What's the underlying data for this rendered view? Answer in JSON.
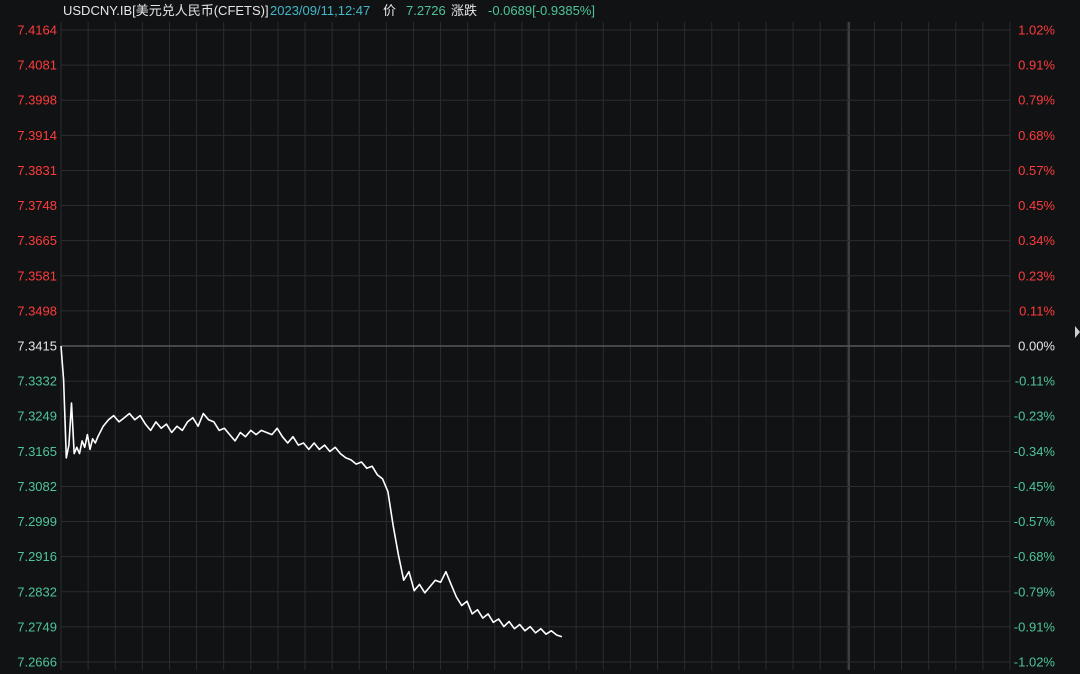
{
  "header": {
    "symbol": "USDCNY.IB[美元兑人民币(CFETS)]",
    "time": "2023/09/11,12:47",
    "price_label": "价",
    "price_value": "7.2726",
    "change_label": "涨跌",
    "change_value": "-0.0689[-0.9385%]"
  },
  "colors": {
    "background": "#111214",
    "grid": "#2b2c31",
    "baseline": "#55575c",
    "up": "#ff3b3b",
    "down": "#4ec49a",
    "neutral": "#e6e6e6",
    "line": "#ffffff"
  },
  "chart_data": {
    "type": "line",
    "title": "",
    "xlabel": "",
    "ylabel": "",
    "ylim": [
      7.2666,
      7.4164
    ],
    "reference_price": 7.3415,
    "grid": true,
    "y_ticks_left": [
      "7.4164",
      "7.4081",
      "7.3998",
      "7.3914",
      "7.3831",
      "7.3748",
      "7.3665",
      "7.3581",
      "7.3498",
      "7.3415",
      "7.3332",
      "7.3249",
      "7.3165",
      "7.3082",
      "7.2999",
      "7.2916",
      "7.2832",
      "7.2749",
      "7.2666"
    ],
    "y_ticks_right": [
      "1.02%",
      "0.91%",
      "0.79%",
      "0.68%",
      "0.57%",
      "0.45%",
      "0.34%",
      "0.23%",
      "0.11%",
      "0.00%",
      "-0.11%",
      "-0.23%",
      "-0.34%",
      "-0.45%",
      "-0.57%",
      "-0.68%",
      "-0.79%",
      "-0.91%",
      "-1.02%"
    ],
    "x_range": [
      0,
      360
    ],
    "series": [
      {
        "x": [
          0,
          1,
          2,
          3,
          4,
          5,
          6,
          7,
          8,
          9,
          10,
          11,
          12,
          13,
          14,
          16,
          18,
          20,
          22,
          24,
          26,
          28,
          30,
          32,
          34,
          36,
          38,
          40,
          42,
          44,
          46,
          48,
          50,
          52,
          54,
          56,
          58,
          60,
          62,
          64,
          66,
          68,
          70,
          72,
          74,
          76,
          78,
          80,
          82,
          84,
          86,
          88,
          90,
          92,
          94,
          96,
          98,
          100,
          102,
          104,
          106,
          108,
          110,
          112,
          114,
          116,
          118,
          120,
          122,
          124,
          126,
          128,
          130,
          132,
          134,
          136,
          138,
          140,
          142,
          144,
          146,
          148,
          150,
          152,
          154,
          156,
          158,
          160,
          162,
          164,
          166,
          168,
          170,
          172,
          174,
          176,
          178,
          180,
          182,
          184,
          186,
          188,
          190
        ],
        "y": [
          7.3415,
          7.3335,
          7.315,
          7.318,
          7.328,
          7.316,
          7.3175,
          7.316,
          7.319,
          7.3175,
          7.3205,
          7.317,
          7.3195,
          7.3185,
          7.32,
          7.3225,
          7.324,
          7.325,
          7.3235,
          7.3245,
          7.3255,
          7.324,
          7.325,
          7.323,
          7.3215,
          7.3235,
          7.322,
          7.323,
          7.321,
          7.3225,
          7.3215,
          7.3235,
          7.3245,
          7.3225,
          7.3255,
          7.324,
          7.3235,
          7.3215,
          7.322,
          7.3205,
          7.319,
          7.321,
          7.32,
          7.3215,
          7.3205,
          7.3215,
          7.321,
          7.3205,
          7.322,
          7.32,
          7.3185,
          7.32,
          7.318,
          7.3185,
          7.317,
          7.3185,
          7.317,
          7.318,
          7.3165,
          7.3175,
          7.316,
          7.315,
          7.3145,
          7.3135,
          7.314,
          7.3125,
          7.313,
          7.311,
          7.31,
          7.307,
          7.299,
          7.292,
          7.286,
          7.288,
          7.2835,
          7.285,
          7.283,
          7.2845,
          7.286,
          7.2855,
          7.288,
          7.285,
          7.282,
          7.28,
          7.281,
          7.278,
          7.279,
          7.277,
          7.278,
          7.276,
          7.2768,
          7.275,
          7.2762,
          7.2745,
          7.2755,
          7.274,
          7.275,
          7.2735,
          7.2745,
          7.2732,
          7.274,
          7.273,
          7.2726
        ]
      }
    ]
  }
}
